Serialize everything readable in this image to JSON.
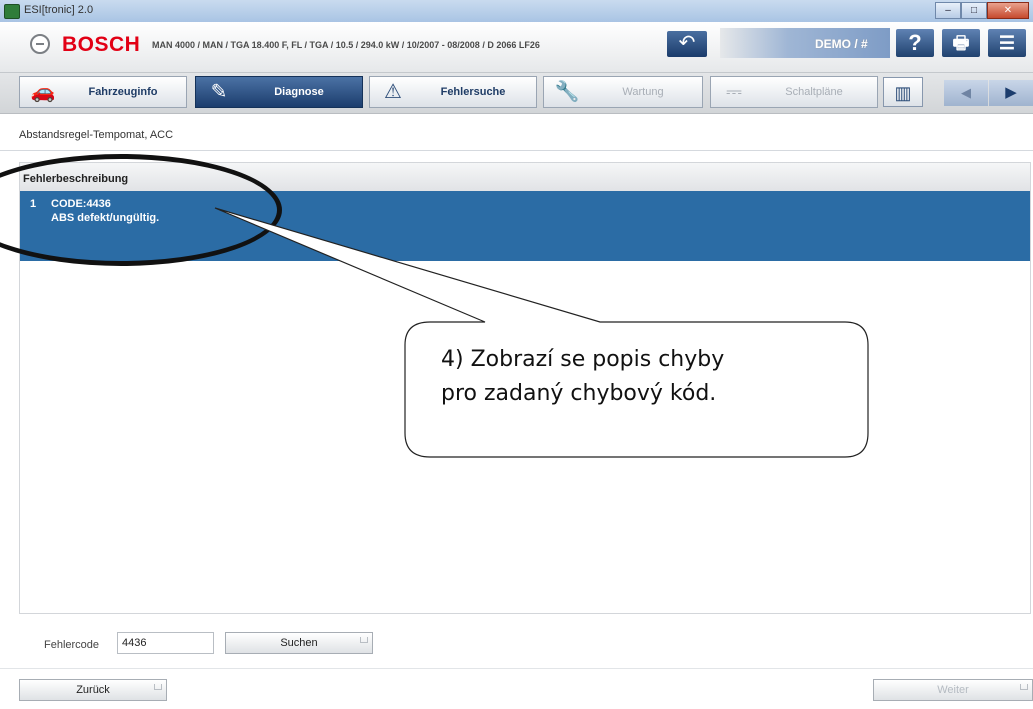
{
  "window": {
    "title": "ESI[tronic] 2.0",
    "buttons": [
      "–",
      "□",
      "✕"
    ]
  },
  "header": {
    "brand": "BOSCH",
    "vehicle": "MAN 4000 / MAN / TGA 18.400 F, FL / TGA / 10.5 / 294.0 kW / 10/2007 - 08/2008 / D 2066 LF26",
    "back_glyph": "↶",
    "demo": "DEMO / #",
    "help_glyph": "?",
    "print_glyph": "🖶",
    "menu_glyph": "☰"
  },
  "tabs": [
    {
      "label": "Fahrzeuginfo",
      "icon": "car-icon",
      "glyph": "🚗",
      "state": "normal"
    },
    {
      "label": "Diagnose",
      "icon": "diagnosis-plug-icon",
      "glyph": "✎",
      "state": "active"
    },
    {
      "label": "Fehlersuche",
      "icon": "troubleshooting-icon",
      "glyph": "⚠",
      "state": "normal"
    },
    {
      "label": "Wartung",
      "icon": "wrench-icon",
      "glyph": "🔧",
      "state": "disabled"
    },
    {
      "label": "Schaltpläne",
      "icon": "circuit-diagram-icon",
      "glyph": "⎓",
      "state": "disabled"
    }
  ],
  "nav": {
    "book_glyph": "▥",
    "prev_glyph": "◀",
    "next_glyph": "▶"
  },
  "breadcrumb": "Abstandsregel-Tempomat, ACC",
  "panel": {
    "title": "Fehlerbeschreibung",
    "faults": [
      {
        "number": "1",
        "code": "CODE:4436",
        "description": "ABS defekt/ungültig."
      }
    ]
  },
  "annotation": {
    "line1": "4) Zobrazí se popis chyby",
    "line2": "pro zadaný chybový kód."
  },
  "form": {
    "code_label": "Fehlercode",
    "code_value": "4436",
    "search_label": "Suchen",
    "back_label": "Zurück",
    "next_label": "Weiter"
  },
  "colors": {
    "brand_red": "#e20015",
    "selection_blue": "#2b6ca5",
    "active_tab": "#1c3d6d"
  }
}
